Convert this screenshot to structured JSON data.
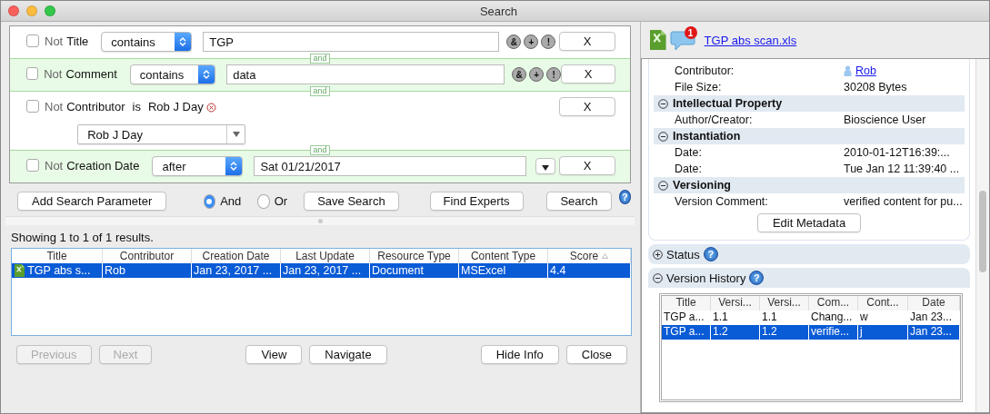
{
  "window": {
    "title": "Search"
  },
  "criteria": [
    {
      "kind": "text",
      "negate": false,
      "not_label": "Not",
      "field": "Title",
      "operator": "contains",
      "value": "TGP",
      "actions": [
        "&",
        "+",
        "!"
      ],
      "remove": "X"
    },
    {
      "kind": "text",
      "negate": false,
      "not_label": "Not",
      "field": "Comment",
      "operator": "contains",
      "value": "data",
      "actions": [
        "&",
        "+",
        "!"
      ],
      "remove": "X",
      "connector": "and"
    },
    {
      "kind": "person",
      "negate": false,
      "not_label": "Not",
      "field": "Contributor",
      "operator": "is",
      "chip": "Rob J Day",
      "value": "Rob J Day",
      "remove": "X",
      "connector": "and"
    },
    {
      "kind": "date",
      "negate": false,
      "not_label": "Not",
      "field": "Creation Date",
      "operator": "after",
      "value": "Sat 01/21/2017",
      "remove": "X",
      "connector": "and"
    }
  ],
  "search_bar": {
    "add": "Add Search Parameter",
    "modes": [
      {
        "label": "And",
        "selected": true
      },
      {
        "label": "Or",
        "selected": false
      }
    ],
    "save": "Save Search",
    "experts": "Find Experts",
    "search": "Search",
    "help": "?"
  },
  "results": {
    "summary": "Showing 1 to 1 of 1 results.",
    "columns": [
      {
        "label": "Title",
        "sorted": false
      },
      {
        "label": "Contributor",
        "sorted": false
      },
      {
        "label": "Creation Date",
        "sorted": false
      },
      {
        "label": "Last Update",
        "sorted": false
      },
      {
        "label": "Resource Type",
        "sorted": false
      },
      {
        "label": "Content Type",
        "sorted": false
      },
      {
        "label": "Score",
        "sorted": true
      }
    ],
    "rows": [
      {
        "selected": true,
        "cells": [
          "TGP abs s...",
          "Rob",
          "Jan 23, 2017 ...",
          "Jan 23, 2017 ...",
          "Document",
          "MSExcel",
          "4.4"
        ]
      }
    ]
  },
  "footer_buttons": [
    {
      "label": "Previous",
      "disabled": true
    },
    {
      "label": "Next",
      "disabled": true
    },
    {
      "label": "View",
      "disabled": false
    },
    {
      "label": "Navigate",
      "disabled": false
    },
    {
      "label": "Hide Info",
      "disabled": false
    },
    {
      "label": "Close",
      "disabled": false
    }
  ],
  "info": {
    "file_link": "TGP abs scan.xls",
    "comment_badge": "1",
    "metadata": [
      {
        "kind": "field",
        "label": "Contributor:",
        "value": "Rob",
        "link": true
      },
      {
        "kind": "field",
        "label": "File Size:",
        "value": "30208 Bytes",
        "link": false
      },
      {
        "kind": "section",
        "label": "Intellectual Property",
        "expanded": true
      },
      {
        "kind": "field",
        "label": "Author/Creator:",
        "value": "Bioscience User",
        "link": false
      },
      {
        "kind": "section",
        "label": "Instantiation",
        "expanded": true
      },
      {
        "kind": "field",
        "label": "Date:",
        "value": "2010-01-12T16:39:...",
        "link": false
      },
      {
        "kind": "field",
        "label": "Date:",
        "value": "Tue Jan 12 11:39:40 ...",
        "link": false
      },
      {
        "kind": "section",
        "label": "Versioning",
        "expanded": true
      },
      {
        "kind": "field",
        "label": "Version Comment:",
        "value": "verified content for pu...",
        "link": false
      }
    ],
    "edit_button": "Edit Metadata",
    "panels": [
      {
        "title": "Status",
        "expanded": false,
        "help": "?"
      },
      {
        "title": "Version History",
        "expanded": true,
        "help": "?"
      }
    ],
    "versions": {
      "columns": [
        "Title",
        "Versi...",
        "Versi...",
        "Com...",
        "Cont...",
        "Date"
      ],
      "rows": [
        {
          "selected": false,
          "cells": [
            "TGP a...",
            "1.1",
            "1.1",
            "Chang...",
            "w",
            "Jan 23..."
          ]
        },
        {
          "selected": true,
          "cells": [
            "TGP a...",
            "1.2",
            "1.2",
            "verifie...",
            "j",
            "Jan 23..."
          ]
        }
      ]
    }
  }
}
